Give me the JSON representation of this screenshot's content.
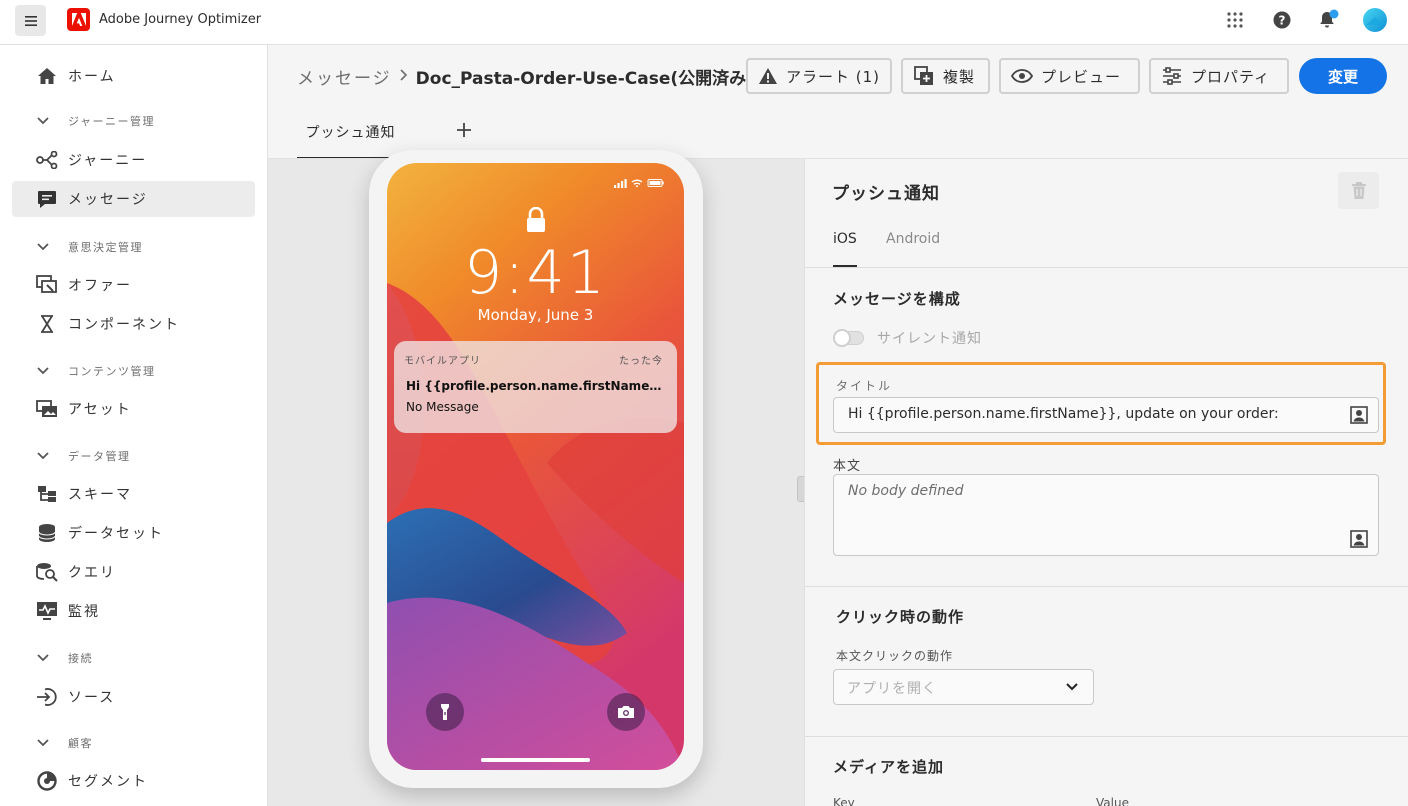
{
  "app": {
    "name": "Adobe Journey Optimizer"
  },
  "sidebar": {
    "home": "ホーム",
    "sections": [
      {
        "title": "ジャーニー管理",
        "items": [
          "ジャーニー",
          "メッセージ"
        ]
      },
      {
        "title": "意思決定管理",
        "items": [
          "オファー",
          "コンポーネント"
        ]
      },
      {
        "title": "コンテンツ管理",
        "items": [
          "アセット"
        ]
      },
      {
        "title": "データ管理",
        "items": [
          "スキーマ",
          "データセット",
          "クエリ",
          "監視"
        ]
      },
      {
        "title": "接続",
        "items": [
          "ソース"
        ]
      },
      {
        "title": "顧客",
        "items": [
          "セグメント"
        ]
      }
    ],
    "active_item": "メッセージ"
  },
  "header": {
    "breadcrumb_root": "メッセージ",
    "breadcrumb_current": "Doc_Pasta-Order-Use-Case(公開済み)",
    "alert_label": "アラート (1)",
    "duplicate_label": "複製",
    "preview_label": "プレビュー",
    "properties_label": "プロパティ",
    "primary_label": "変更",
    "tab_label": "プッシュ通知",
    "add_tab": "+"
  },
  "lockscreen": {
    "time": "9:41",
    "date": "Monday, June 3",
    "notification": {
      "app": "モバイルアプリ",
      "time": "たった今",
      "title": "Hi {{profile.person.name.firstName}}, update on your order:",
      "body": "No Message"
    }
  },
  "panel": {
    "title": "プッシュ通知",
    "os_tabs": [
      "iOS",
      "Android"
    ],
    "active_os": "iOS",
    "compose_title": "メッセージを構成",
    "silent_label": "サイレント通知",
    "silent_enabled": false,
    "title_label": "タイトル",
    "title_value": "Hi {{profile.person.name.firstName}}, update on your order:",
    "body_label": "本文",
    "body_placeholder": "No body defined",
    "click_title": "クリック時の動作",
    "click_label": "本文クリックの動作",
    "click_value": "アプリを開く",
    "media_title": "メディアを追加",
    "key_label": "Key",
    "value_label": "Value"
  },
  "colors": {
    "accent": "#1473e6",
    "highlight": "#f39c35",
    "adobe_red": "#eb1000"
  }
}
